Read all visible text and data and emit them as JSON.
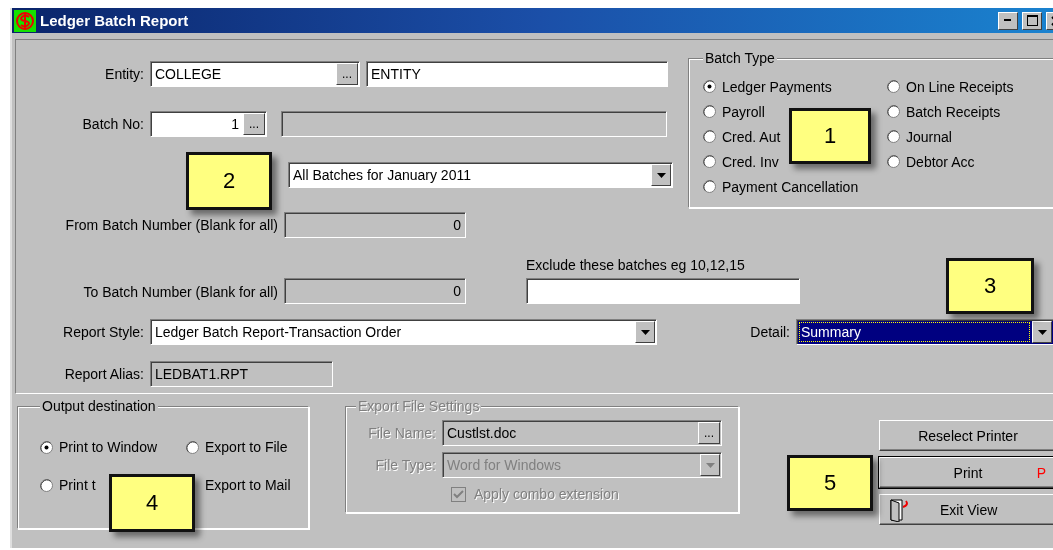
{
  "window": {
    "title": "Ledger Batch Report"
  },
  "form": {
    "entity": {
      "label": "Entity:",
      "code": "COLLEGE",
      "lookup": "...",
      "description": "ENTITY"
    },
    "batch_no": {
      "label": "Batch No:",
      "value": "1",
      "lookup": "..."
    },
    "batch_range": {
      "value": "All Batches for January 2011"
    },
    "from_batch": {
      "label": "From Batch Number  (Blank for all)",
      "value": "0"
    },
    "to_batch": {
      "label": "To Batch Number (Blank for all)",
      "value": "0"
    },
    "exclude": {
      "label": "Exclude these batches  eg 10,12,15"
    },
    "report_style": {
      "label": "Report Style:",
      "value": "Ledger Batch Report-Transaction Order"
    },
    "detail": {
      "label": "Detail:",
      "value": "Summary",
      "focused": true
    },
    "report_alias": {
      "label": "Report Alias:",
      "value": "LEDBAT1.RPT"
    }
  },
  "batch_type": {
    "title": "Batch Type",
    "options": [
      {
        "label": "Ledger Payments",
        "selected": true
      },
      {
        "label": "Payroll",
        "selected": false
      },
      {
        "label": "Cred. Aut",
        "selected": false
      },
      {
        "label": "Cred. Inv",
        "selected": false
      },
      {
        "label": "Payment Cancellation",
        "selected": false
      },
      {
        "label": "On Line Receipts",
        "selected": false
      },
      {
        "label": "Batch Receipts",
        "selected": false
      },
      {
        "label": "Journal",
        "selected": false
      },
      {
        "label": "Debtor Acc",
        "selected": false
      }
    ]
  },
  "output_destination": {
    "title": "Output destination",
    "options": [
      {
        "label": "Print to Window",
        "selected": true
      },
      {
        "label": "Export to File",
        "selected": false
      },
      {
        "label": "Print t",
        "selected": false
      },
      {
        "label": "Export to Mail"
      }
    ]
  },
  "export_settings": {
    "title": "Export  File Settings",
    "disabled": true,
    "file_name": {
      "label": "File Name:",
      "value": "Custlst.doc",
      "lookup": "..."
    },
    "file_type": {
      "label": "File Type:",
      "value": "Word for Windows"
    },
    "apply_combo": {
      "label": "Apply combo extension",
      "checked": true
    }
  },
  "buttons": [
    {
      "label": "Reselect Printer",
      "kind": "plain"
    },
    {
      "label": "Print",
      "kind": "default",
      "hotkey": "P"
    },
    {
      "label": "Exit View",
      "kind": "icon"
    }
  ],
  "callouts": [
    {
      "number": "1"
    },
    {
      "number": "2"
    },
    {
      "number": "3"
    },
    {
      "number": "4"
    },
    {
      "number": "5"
    }
  ]
}
